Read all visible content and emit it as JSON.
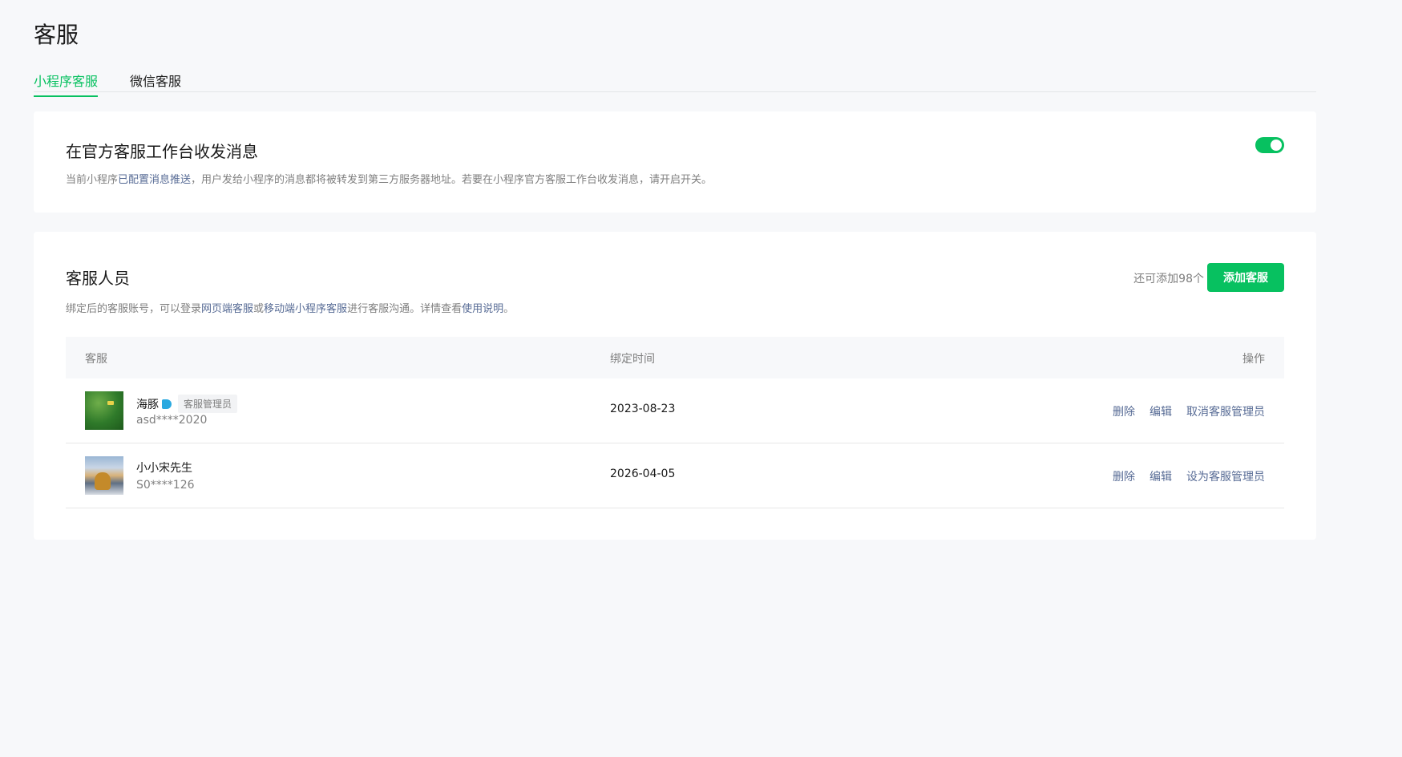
{
  "page": {
    "title": "客服"
  },
  "tabs": [
    {
      "label": "小程序客服",
      "active": true
    },
    {
      "label": "微信客服",
      "active": false
    }
  ],
  "message_card": {
    "title": "在官方客服工作台收发消息",
    "desc_prefix": "当前小程序",
    "desc_link": "已配置消息推送",
    "desc_suffix": "，用户发给小程序的消息都将被转发到第三方服务器地址。若要在小程序官方客服工作台收发消息，请开启开关。",
    "toggle_on": true
  },
  "staff_card": {
    "title": "客服人员",
    "desc_part1": "绑定后的客服账号，可以登录",
    "link_web": "网页端客服",
    "desc_part2": "或",
    "link_mobile": "移动端小程序客服",
    "desc_part3": "进行客服沟通。详情查看",
    "link_help": "使用说明",
    "desc_part4": "。",
    "remaining": "还可添加98个",
    "add_button": "添加客服"
  },
  "table": {
    "headers": {
      "name": "客服",
      "time": "绑定时间",
      "ops": "操作"
    },
    "rows": [
      {
        "name": "海豚",
        "account": "asd****2020",
        "role_tag": "客服管理员",
        "bind_time": "2023-08-23",
        "op_delete": "删除",
        "op_edit": "编辑",
        "op_admin": "取消客服管理员"
      },
      {
        "name": "小小宋先生",
        "account": "S0****126",
        "bind_time": "2026-04-05",
        "op_delete": "删除",
        "op_edit": "编辑",
        "op_admin": "设为客服管理员"
      }
    ]
  },
  "colors": {
    "accent": "#07c160",
    "link": "#576b95",
    "background": "#f7f8fa"
  },
  "icons": {
    "verified": "verified-badge-icon"
  }
}
